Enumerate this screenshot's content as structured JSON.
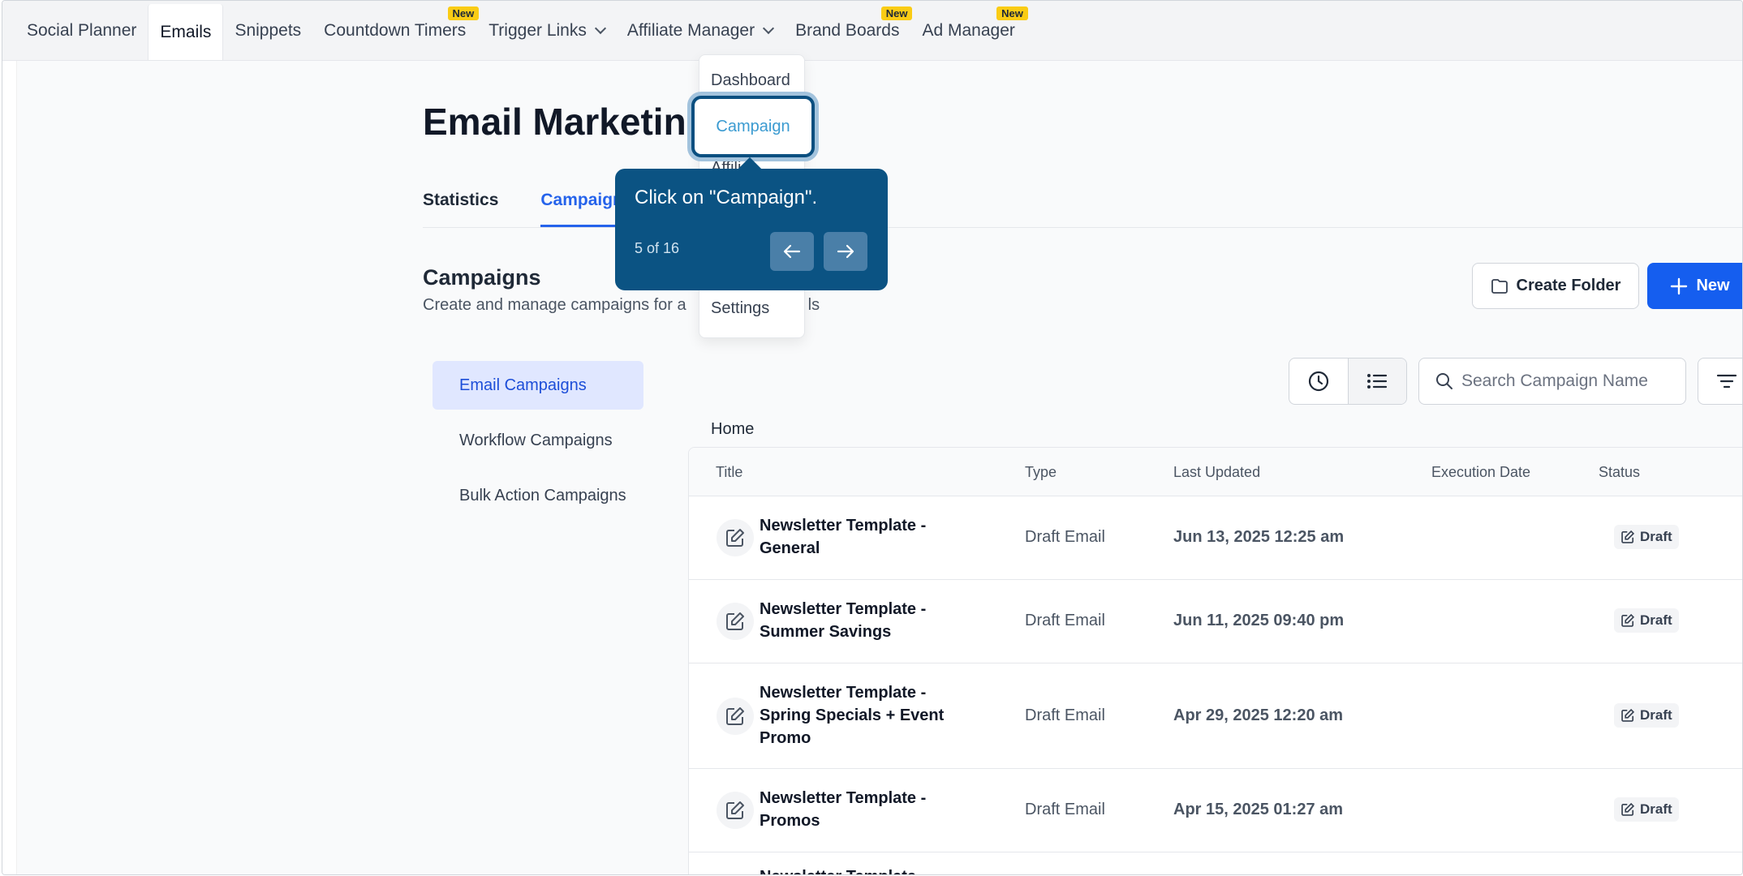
{
  "topnav": {
    "items": [
      {
        "label": "Social Planner",
        "badge": ""
      },
      {
        "label": "Emails",
        "badge": "",
        "active": true
      },
      {
        "label": "Snippets",
        "badge": ""
      },
      {
        "label": "Countdown Timers",
        "badge": "New"
      },
      {
        "label": "Trigger Links",
        "badge": ""
      },
      {
        "label": "Affiliate Manager",
        "badge": ""
      },
      {
        "label": "Brand Boards",
        "badge": "New"
      },
      {
        "label": "Ad Manager",
        "badge": "New"
      }
    ]
  },
  "page": {
    "title": "Email Marketing",
    "tabs": [
      "Statistics",
      "Campaigns"
    ],
    "section_title": "Campaigns",
    "section_sub_start": "Create and manage campaigns for a",
    "section_sub_end": "ls",
    "create_folder_label": "Create Folder",
    "new_label": "New"
  },
  "subnav": {
    "items": [
      "Email Campaigns",
      "Workflow Campaigns",
      "Bulk Action Campaigns"
    ]
  },
  "search": {
    "placeholder": "Search Campaign Name"
  },
  "breadcrumb": "Home",
  "table": {
    "headers": [
      "Title",
      "Type",
      "Last Updated",
      "Execution Date",
      "Status"
    ],
    "rows": [
      {
        "title": "Newsletter Template - General",
        "type": "Draft Email",
        "updated": "Jun 13, 2025 12:25 am",
        "status": "Draft"
      },
      {
        "title": "Newsletter Template - Summer Savings",
        "type": "Draft Email",
        "updated": "Jun 11, 2025 09:40 pm",
        "status": "Draft"
      },
      {
        "title": "Newsletter Template - Spring Specials + Event Promo",
        "type": "Draft Email",
        "updated": "Apr 29, 2025 12:20 am",
        "status": "Draft"
      },
      {
        "title": "Newsletter Template - Promos",
        "type": "Draft Email",
        "updated": "Apr 15, 2025 01:27 am",
        "status": "Draft"
      },
      {
        "title": "Newsletter Template",
        "type": "",
        "updated": "",
        "status": ""
      }
    ]
  },
  "dropdown": {
    "items": [
      "Dashboard",
      "Campaign",
      "Affili",
      "Settings"
    ]
  },
  "tooltip": {
    "text": "Click on \"Campaign\".",
    "step": "5 of 16"
  },
  "colors": {
    "accent": "#155eef",
    "tooltip_bg": "#0b5383",
    "badge": "#facc15"
  }
}
